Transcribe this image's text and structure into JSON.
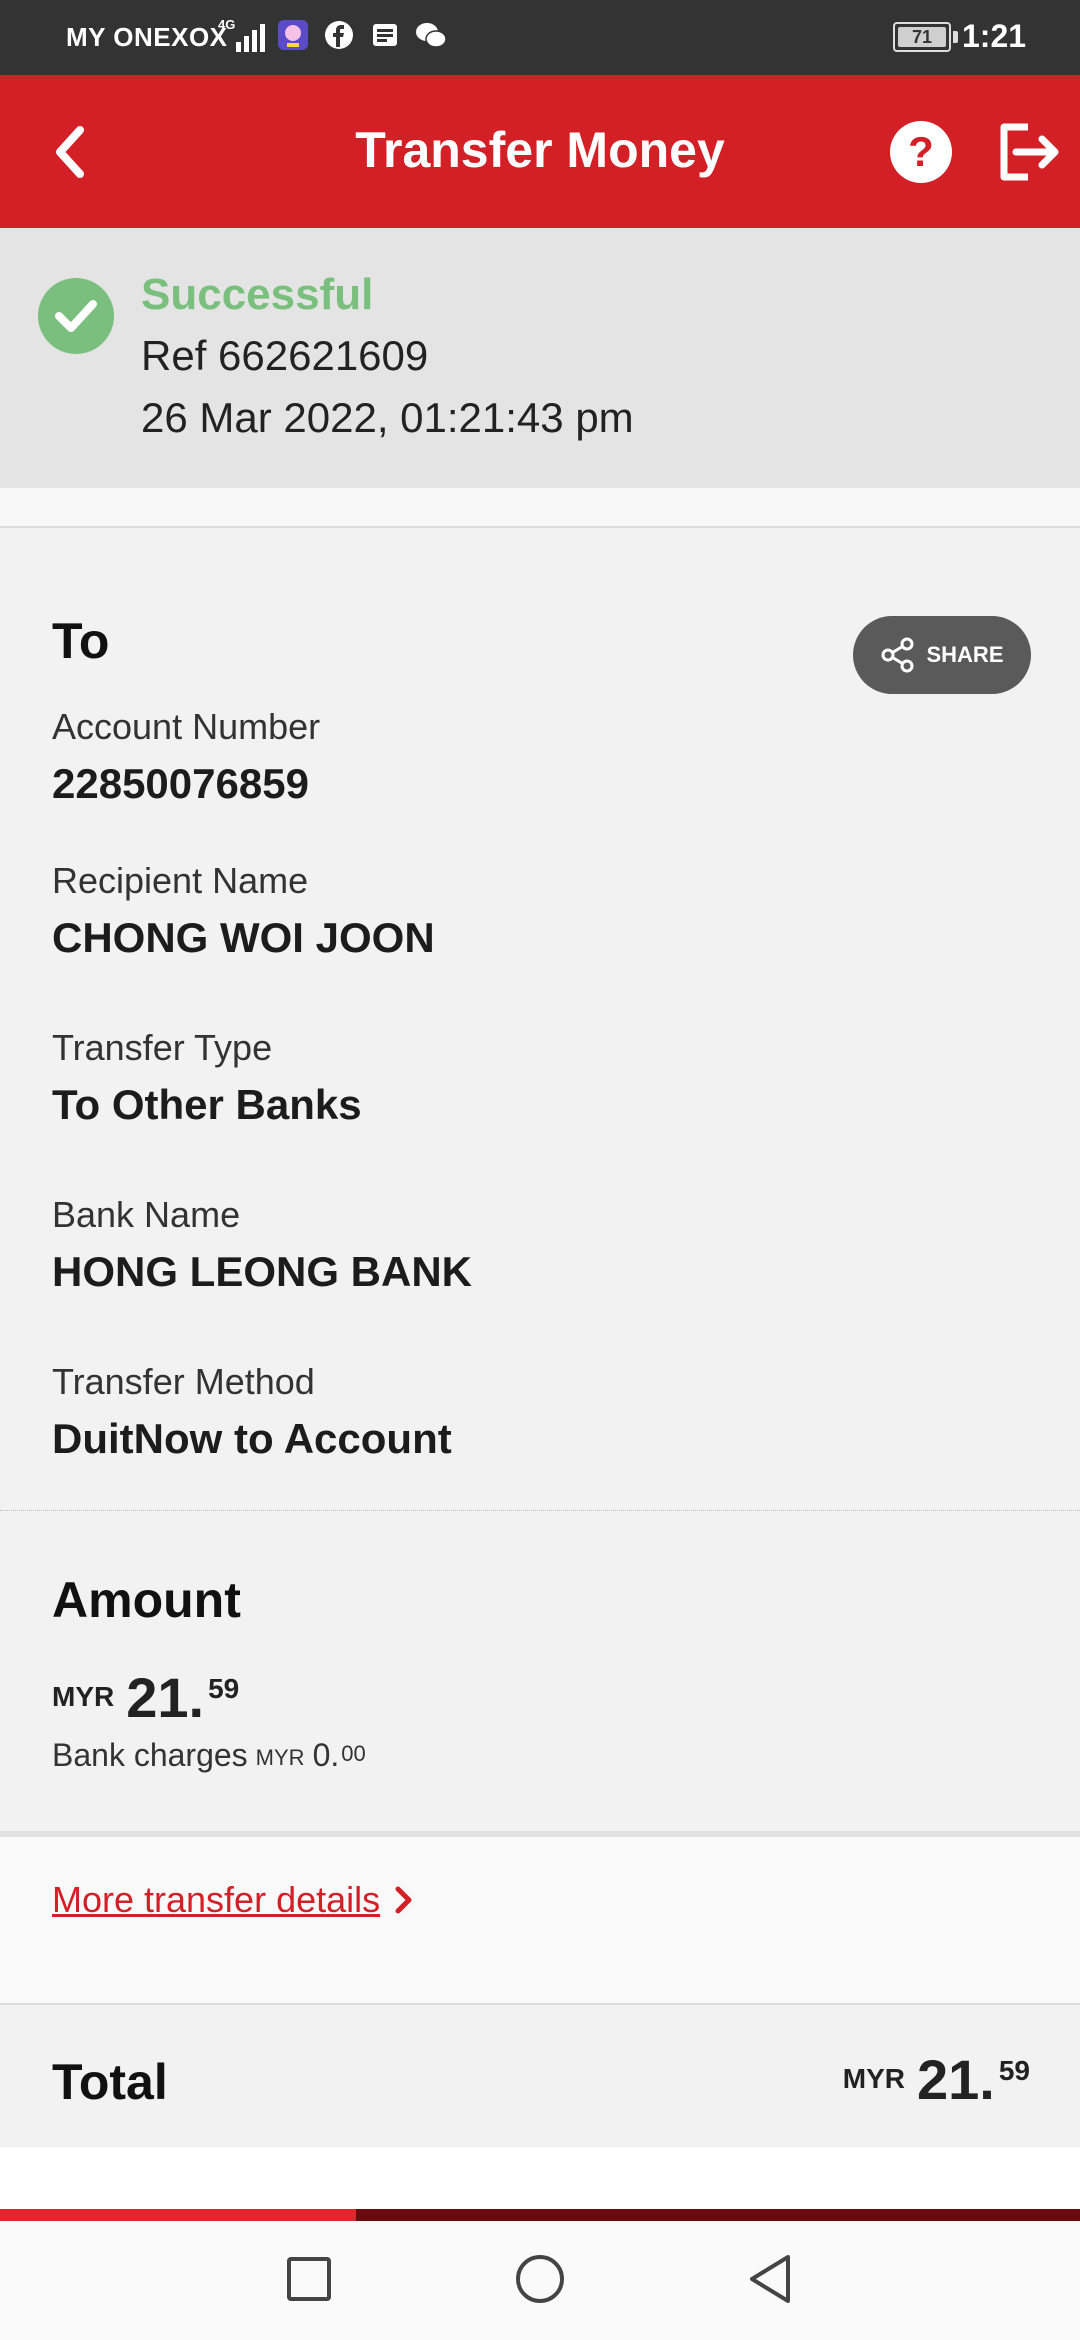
{
  "status_bar": {
    "carrier": "MY ONEXOX",
    "network": "4G",
    "battery": "71",
    "time": "1:21"
  },
  "header": {
    "title": "Transfer Money",
    "help_icon": "question-icon",
    "logout_icon": "logout-icon",
    "back_icon": "chevron-left-icon",
    "color": "#d31f26"
  },
  "status": {
    "label": "Successful",
    "ref": "Ref 662621609",
    "datetime": "26 Mar 2022, 01:21:43 pm",
    "color": "#7bbf7f"
  },
  "recipient": {
    "section_title": "To",
    "share_label": "SHARE",
    "fields": [
      {
        "label": "Account Number",
        "value": "22850076859"
      },
      {
        "label": "Recipient Name",
        "value": "CHONG WOI JOON"
      },
      {
        "label": "Transfer Type",
        "value": "To Other Banks"
      },
      {
        "label": "Bank Name",
        "value": "HONG LEONG BANK"
      },
      {
        "label": "Transfer Method",
        "value": "DuitNow to Account"
      }
    ]
  },
  "amount": {
    "section_title": "Amount",
    "currency": "MYR",
    "whole": "21.",
    "cents": "59",
    "charges_label": "Bank charges",
    "charges_currency": "MYR",
    "charges_whole": "0.",
    "charges_cents": "00"
  },
  "more_link": {
    "label": "More transfer details"
  },
  "total": {
    "label": "Total",
    "currency": "MYR",
    "whole": "21.",
    "cents": "59"
  },
  "progress": {
    "fraction": 0.33
  },
  "nav": {
    "recents_icon": "square-icon",
    "home_icon": "circle-icon",
    "back_icon": "triangle-back-icon"
  }
}
